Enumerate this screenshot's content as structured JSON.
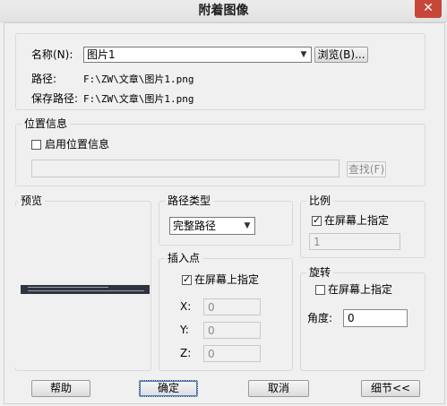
{
  "window": {
    "title": "附着图像",
    "close_glyph": "✕"
  },
  "name_section": {
    "name_label": "名称(N):",
    "name_value": "图片1",
    "browse_label": "浏览(B)...",
    "path_label": "路径:",
    "path_value": "F:\\ZW\\文章\\图片1.png",
    "saved_path_label": "保存路径:",
    "saved_path_value": "F:\\ZW\\文章\\图片1.png"
  },
  "location": {
    "group_title": "位置信息",
    "enable_label": "启用位置信息",
    "enable_checked": false,
    "location_value": "",
    "find_label": "查找(F)"
  },
  "preview": {
    "group_title": "预览"
  },
  "path_type": {
    "group_title": "路径类型",
    "selected": "完整路径"
  },
  "scale": {
    "group_title": "比例",
    "on_screen_label": "在屏幕上指定",
    "on_screen_checked": true,
    "value": "1"
  },
  "insertion": {
    "group_title": "插入点",
    "on_screen_label": "在屏幕上指定",
    "on_screen_checked": true,
    "x_label": "X:",
    "x_value": "0",
    "y_label": "Y:",
    "y_value": "0",
    "z_label": "Z:",
    "z_value": "0"
  },
  "rotation": {
    "group_title": "旋转",
    "on_screen_label": "在屏幕上指定",
    "on_screen_checked": false,
    "angle_label": "角度:",
    "angle_value": "0"
  },
  "buttons": {
    "help": "帮助",
    "ok": "确定",
    "cancel": "取消",
    "details": "细节<<"
  },
  "icons": {
    "dropdown": "chevron-down-icon",
    "check": "check-icon",
    "close": "close-icon"
  }
}
